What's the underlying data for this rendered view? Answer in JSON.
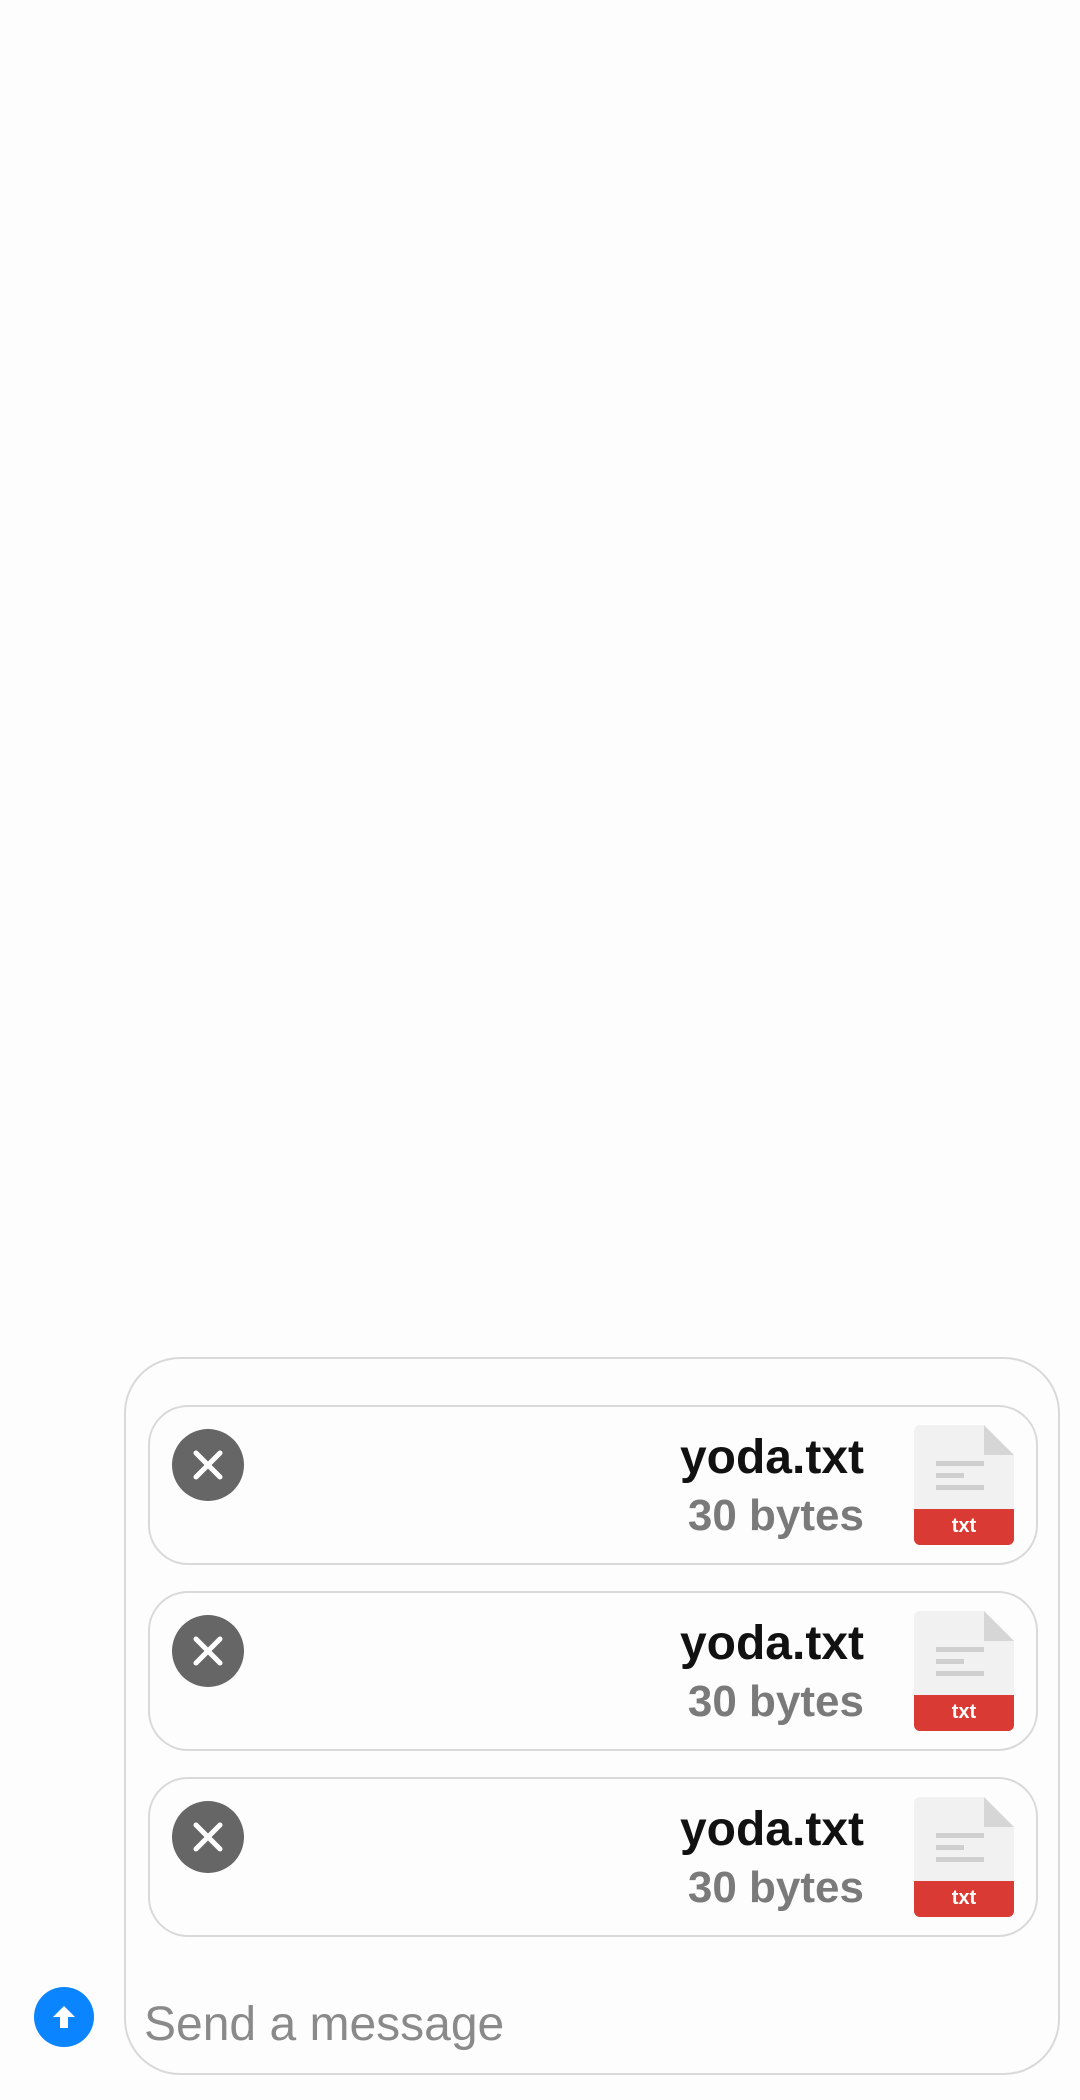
{
  "composer": {
    "attachments": [
      {
        "name": "yoda.txt",
        "size": "30 bytes",
        "ext": "txt",
        "icon": "file-txt-icon"
      },
      {
        "name": "yoda.txt",
        "size": "30 bytes",
        "ext": "txt",
        "icon": "file-txt-icon"
      },
      {
        "name": "yoda.txt",
        "size": "30 bytes",
        "ext": "txt",
        "icon": "file-txt-icon"
      }
    ],
    "remove_icon": "close-circle-icon",
    "input": {
      "value": "",
      "placeholder": "Send a message"
    },
    "send_icon": "arrow-up-icon"
  },
  "colors": {
    "accent": "#0a84ff",
    "remove_button": "#666666",
    "file_badge": "#d93a34",
    "border": "#d9d9d9",
    "secondary_text": "#7a7a7a"
  }
}
